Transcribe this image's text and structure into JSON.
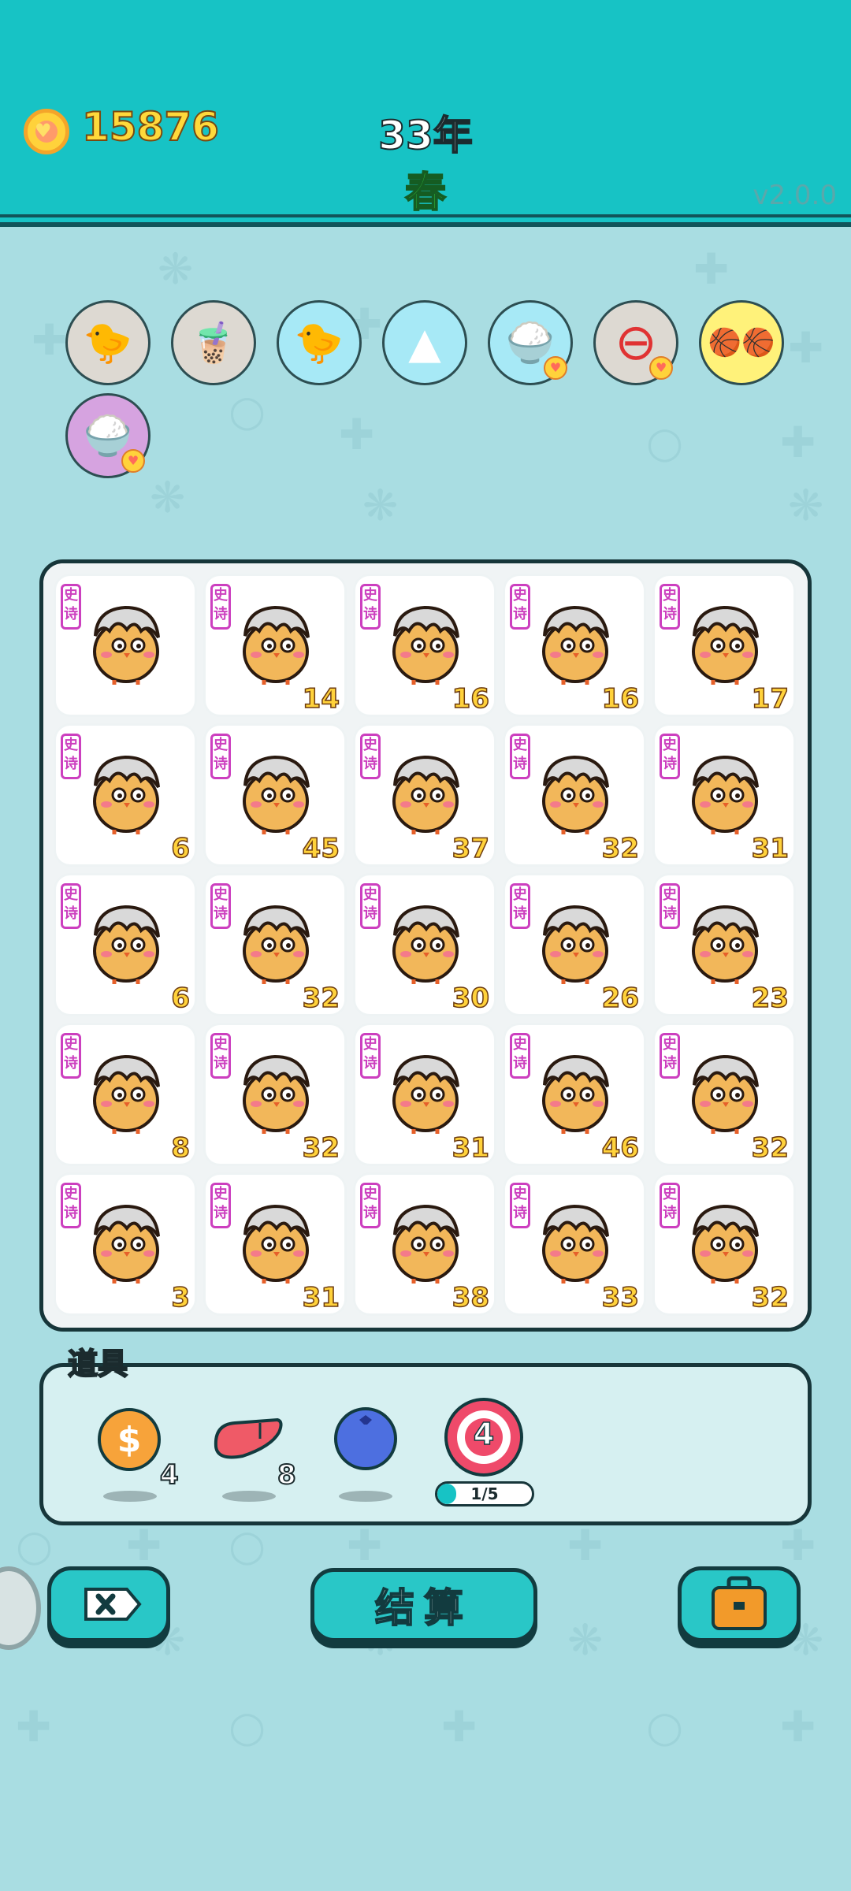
{
  "header": {
    "coins": "15876",
    "year": "33年",
    "season": "春",
    "version": "v2.0.0"
  },
  "status_items": [
    {
      "icon": "chicken-with-egg-icon"
    },
    {
      "icon": "bubble-tea-icon"
    },
    {
      "icon": "chicken-with-egg-icon"
    },
    {
      "icon": "pleated-skirt-icon"
    },
    {
      "icon": "rice-bowl-icon"
    },
    {
      "icon": "minus-circle-icon"
    },
    {
      "icon": "basketballs-icon"
    },
    {
      "icon": "rice-bowl-icon"
    }
  ],
  "board": {
    "tag": "史诗",
    "cells": [
      {
        "value": ""
      },
      {
        "value": "14"
      },
      {
        "value": "16"
      },
      {
        "value": "16"
      },
      {
        "value": "17"
      },
      {
        "value": "6"
      },
      {
        "value": "45"
      },
      {
        "value": "37"
      },
      {
        "value": "32"
      },
      {
        "value": "31"
      },
      {
        "value": "6"
      },
      {
        "value": "32"
      },
      {
        "value": "30"
      },
      {
        "value": "26"
      },
      {
        "value": "23"
      },
      {
        "value": "8"
      },
      {
        "value": "32"
      },
      {
        "value": "31"
      },
      {
        "value": "46"
      },
      {
        "value": "32"
      },
      {
        "value": "3"
      },
      {
        "value": "31"
      },
      {
        "value": "38"
      },
      {
        "value": "33"
      },
      {
        "value": "32"
      }
    ]
  },
  "items": {
    "title": "道具",
    "list": [
      {
        "icon": "coin-dollar-icon",
        "count": "4"
      },
      {
        "icon": "liver-icon",
        "count": "8"
      },
      {
        "icon": "blueberry-icon",
        "count": ""
      },
      {
        "icon": "target-icon",
        "count": "4",
        "progress_text": "1/5",
        "progress": 0.2
      }
    ]
  },
  "buttons": {
    "settle_label": "结算"
  },
  "colors": {
    "header": "#17c3c5",
    "accent": "#29c7c7",
    "tag": "#cc3fbf",
    "number": "#ffd23b"
  }
}
